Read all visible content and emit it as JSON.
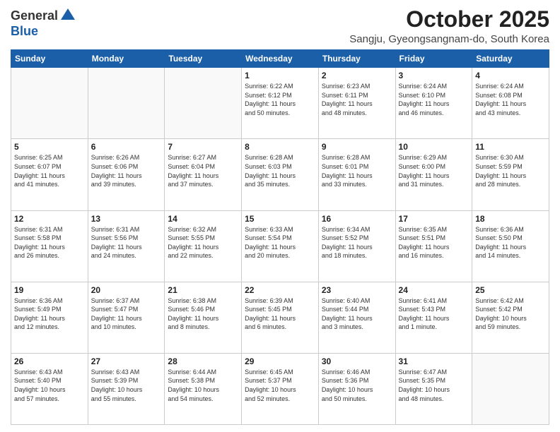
{
  "header": {
    "logo_general": "General",
    "logo_blue": "Blue",
    "month": "October 2025",
    "location": "Sangju, Gyeongsangnam-do, South Korea"
  },
  "days_of_week": [
    "Sunday",
    "Monday",
    "Tuesday",
    "Wednesday",
    "Thursday",
    "Friday",
    "Saturday"
  ],
  "weeks": [
    [
      {
        "day": "",
        "info": ""
      },
      {
        "day": "",
        "info": ""
      },
      {
        "day": "",
        "info": ""
      },
      {
        "day": "1",
        "info": "Sunrise: 6:22 AM\nSunset: 6:12 PM\nDaylight: 11 hours\nand 50 minutes."
      },
      {
        "day": "2",
        "info": "Sunrise: 6:23 AM\nSunset: 6:11 PM\nDaylight: 11 hours\nand 48 minutes."
      },
      {
        "day": "3",
        "info": "Sunrise: 6:24 AM\nSunset: 6:10 PM\nDaylight: 11 hours\nand 46 minutes."
      },
      {
        "day": "4",
        "info": "Sunrise: 6:24 AM\nSunset: 6:08 PM\nDaylight: 11 hours\nand 43 minutes."
      }
    ],
    [
      {
        "day": "5",
        "info": "Sunrise: 6:25 AM\nSunset: 6:07 PM\nDaylight: 11 hours\nand 41 minutes."
      },
      {
        "day": "6",
        "info": "Sunrise: 6:26 AM\nSunset: 6:06 PM\nDaylight: 11 hours\nand 39 minutes."
      },
      {
        "day": "7",
        "info": "Sunrise: 6:27 AM\nSunset: 6:04 PM\nDaylight: 11 hours\nand 37 minutes."
      },
      {
        "day": "8",
        "info": "Sunrise: 6:28 AM\nSunset: 6:03 PM\nDaylight: 11 hours\nand 35 minutes."
      },
      {
        "day": "9",
        "info": "Sunrise: 6:28 AM\nSunset: 6:01 PM\nDaylight: 11 hours\nand 33 minutes."
      },
      {
        "day": "10",
        "info": "Sunrise: 6:29 AM\nSunset: 6:00 PM\nDaylight: 11 hours\nand 31 minutes."
      },
      {
        "day": "11",
        "info": "Sunrise: 6:30 AM\nSunset: 5:59 PM\nDaylight: 11 hours\nand 28 minutes."
      }
    ],
    [
      {
        "day": "12",
        "info": "Sunrise: 6:31 AM\nSunset: 5:58 PM\nDaylight: 11 hours\nand 26 minutes."
      },
      {
        "day": "13",
        "info": "Sunrise: 6:31 AM\nSunset: 5:56 PM\nDaylight: 11 hours\nand 24 minutes."
      },
      {
        "day": "14",
        "info": "Sunrise: 6:32 AM\nSunset: 5:55 PM\nDaylight: 11 hours\nand 22 minutes."
      },
      {
        "day": "15",
        "info": "Sunrise: 6:33 AM\nSunset: 5:54 PM\nDaylight: 11 hours\nand 20 minutes."
      },
      {
        "day": "16",
        "info": "Sunrise: 6:34 AM\nSunset: 5:52 PM\nDaylight: 11 hours\nand 18 minutes."
      },
      {
        "day": "17",
        "info": "Sunrise: 6:35 AM\nSunset: 5:51 PM\nDaylight: 11 hours\nand 16 minutes."
      },
      {
        "day": "18",
        "info": "Sunrise: 6:36 AM\nSunset: 5:50 PM\nDaylight: 11 hours\nand 14 minutes."
      }
    ],
    [
      {
        "day": "19",
        "info": "Sunrise: 6:36 AM\nSunset: 5:49 PM\nDaylight: 11 hours\nand 12 minutes."
      },
      {
        "day": "20",
        "info": "Sunrise: 6:37 AM\nSunset: 5:47 PM\nDaylight: 11 hours\nand 10 minutes."
      },
      {
        "day": "21",
        "info": "Sunrise: 6:38 AM\nSunset: 5:46 PM\nDaylight: 11 hours\nand 8 minutes."
      },
      {
        "day": "22",
        "info": "Sunrise: 6:39 AM\nSunset: 5:45 PM\nDaylight: 11 hours\nand 6 minutes."
      },
      {
        "day": "23",
        "info": "Sunrise: 6:40 AM\nSunset: 5:44 PM\nDaylight: 11 hours\nand 3 minutes."
      },
      {
        "day": "24",
        "info": "Sunrise: 6:41 AM\nSunset: 5:43 PM\nDaylight: 11 hours\nand 1 minute."
      },
      {
        "day": "25",
        "info": "Sunrise: 6:42 AM\nSunset: 5:42 PM\nDaylight: 10 hours\nand 59 minutes."
      }
    ],
    [
      {
        "day": "26",
        "info": "Sunrise: 6:43 AM\nSunset: 5:40 PM\nDaylight: 10 hours\nand 57 minutes."
      },
      {
        "day": "27",
        "info": "Sunrise: 6:43 AM\nSunset: 5:39 PM\nDaylight: 10 hours\nand 55 minutes."
      },
      {
        "day": "28",
        "info": "Sunrise: 6:44 AM\nSunset: 5:38 PM\nDaylight: 10 hours\nand 54 minutes."
      },
      {
        "day": "29",
        "info": "Sunrise: 6:45 AM\nSunset: 5:37 PM\nDaylight: 10 hours\nand 52 minutes."
      },
      {
        "day": "30",
        "info": "Sunrise: 6:46 AM\nSunset: 5:36 PM\nDaylight: 10 hours\nand 50 minutes."
      },
      {
        "day": "31",
        "info": "Sunrise: 6:47 AM\nSunset: 5:35 PM\nDaylight: 10 hours\nand 48 minutes."
      },
      {
        "day": "",
        "info": ""
      }
    ]
  ]
}
